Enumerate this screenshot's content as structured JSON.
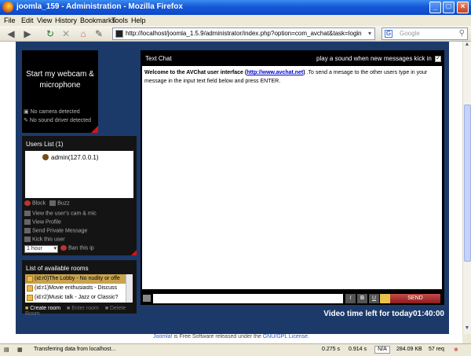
{
  "window": {
    "title": "joomla_159 - Administration - Mozilla Firefox",
    "minimize": "_",
    "maximize": "□",
    "close": "×"
  },
  "menu": [
    "File",
    "Edit",
    "View",
    "History",
    "Bookmarks",
    "Tools",
    "Help"
  ],
  "nav": {
    "url": "http://localhost/joomla_1.5.9/administrator/index.php?option=com_avchat&task=login",
    "search_placeholder": "Google",
    "search_engine_letter": "G"
  },
  "webcam": {
    "label_line1": "Start my webcam &",
    "label_line2": "microphone",
    "no_camera": "No camera detected",
    "no_sound": "No sound driver detected"
  },
  "users": {
    "title": "Users List (1)",
    "items": [
      "admin(127.0.0.1)"
    ],
    "actions": {
      "block": "Block",
      "buzz": "Buzz",
      "view_cam": "View the user's cam & mic",
      "view_profile": "View Profile",
      "send_pm": "Send Private Message",
      "kick": "Kick this user",
      "ban_duration": "1 hour",
      "ban": "Ban this ip"
    }
  },
  "rooms": {
    "title": "List of available rooms",
    "items": [
      "(id:r0)The Lobby - No nudity or offe",
      "(id:r1)Movie enthusiasts - Discuss",
      "(id:r2)Music talk - Jazz or Classic?"
    ],
    "create": "Create room",
    "enter": "Enter room",
    "delete": "Delete Room"
  },
  "chat": {
    "title": "Text Chat",
    "sound_option": "play a sound when new messages kick in",
    "welcome_bold": "Welcome to the AVChat user interface (",
    "welcome_link": "http://www.avchat.net",
    "welcome_close": ")",
    "welcome_rest": ".To send a mesage to the other users type in your message in the input text field below and press ENTER.",
    "btn_italic": "I",
    "btn_bold": "B",
    "btn_underline": "U",
    "send": "SEND",
    "timer_label": "Video time left for today",
    "timer_value": "01:40:00"
  },
  "footer": {
    "joomla": "Joomla!",
    "text": " is Free Software released under the ",
    "license": "GNU/GPL License."
  },
  "status": {
    "message": "Transferring data from localhost...",
    "t1": "0.275 s",
    "t2": "0.914 s",
    "na": "N/A",
    "size": "284.09 KB",
    "reqs": "57 req"
  }
}
